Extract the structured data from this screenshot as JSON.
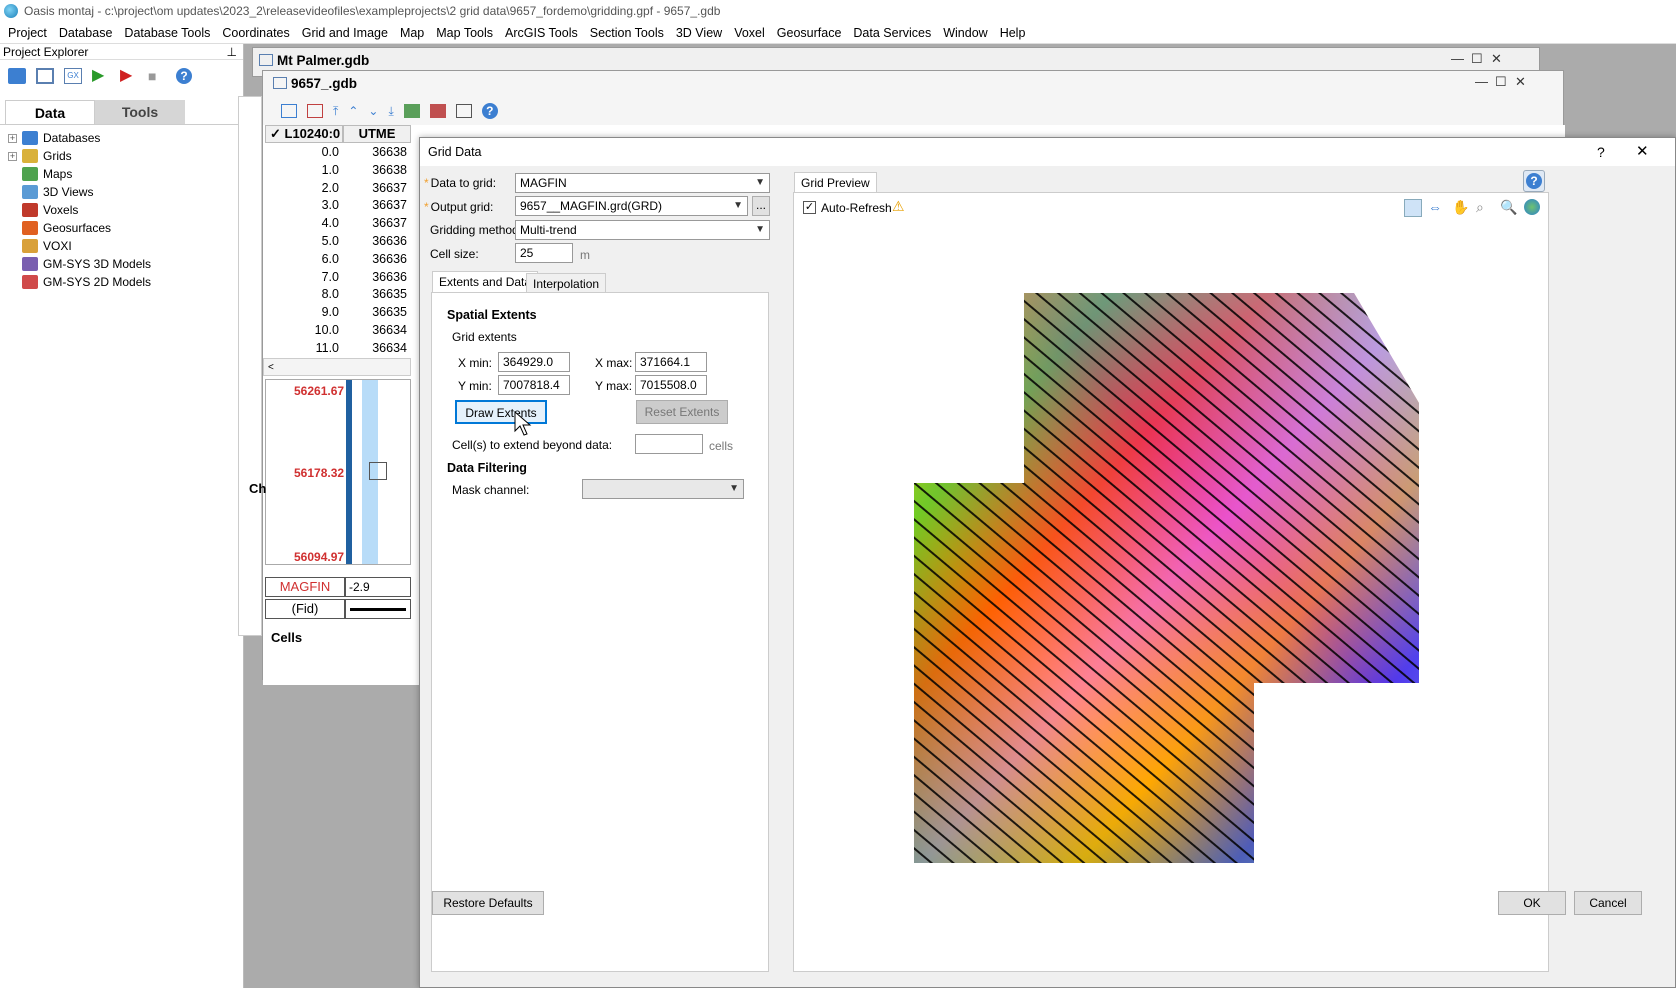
{
  "window_title": "Oasis montaj - c:\\project\\om updates\\2023_2\\releasevideofiles\\exampleprojects\\2 grid data\\9657_fordemo\\gridding.gpf - 9657_.gdb",
  "menu": [
    "Project",
    "Database",
    "Database Tools",
    "Coordinates",
    "Grid and Image",
    "Map",
    "Map Tools",
    "ArcGIS Tools",
    "Section Tools",
    "3D View",
    "Voxel",
    "Geosurface",
    "Data Services",
    "Window",
    "Help"
  ],
  "explorer": {
    "title": "Project Explorer",
    "tabs": {
      "data": "Data",
      "tools": "Tools"
    },
    "items": [
      {
        "label": "Databases",
        "expandable": true,
        "color": "#3c7fd1"
      },
      {
        "label": "Grids",
        "expandable": true,
        "color": "#d9b13a"
      },
      {
        "label": "Maps",
        "expandable": false,
        "color": "#4fa34f"
      },
      {
        "label": "3D Views",
        "expandable": false,
        "color": "#5b9bd5"
      },
      {
        "label": "Voxels",
        "expandable": false,
        "color": "#c0392b"
      },
      {
        "label": "Geosurfaces",
        "expandable": false,
        "color": "#e06020"
      },
      {
        "label": "VOXI",
        "expandable": false,
        "color": "#d9a13a"
      },
      {
        "label": "GM-SYS 3D Models",
        "expandable": false,
        "color": "#7a5fb0"
      },
      {
        "label": "GM-SYS 2D Models",
        "expandable": false,
        "color": "#d04a4a"
      }
    ]
  },
  "bg_windows": {
    "win1_title": "Mt Palmer.gdb",
    "win2_title": "9657_.gdb",
    "line_header": "L10240:0",
    "col_utme": "UTME",
    "fids": [
      "0.0",
      "1.0",
      "2.0",
      "3.0",
      "4.0",
      "5.0",
      "6.0",
      "7.0",
      "8.0",
      "9.0",
      "10.0",
      "11.0"
    ],
    "utme": [
      "36638",
      "36638",
      "36637",
      "36637",
      "36637",
      "36636",
      "36636",
      "36636",
      "36635",
      "36635",
      "36634",
      "36634"
    ],
    "profile_y": [
      "56261.67",
      "56178.32",
      "56094.97"
    ],
    "magfin_label": "MAGFIN",
    "magfin_value": "-2.9",
    "fid_label": "(Fid)",
    "ch_label": "Ch",
    "cells_label": "Cells"
  },
  "dialog": {
    "title": "Grid Data",
    "help": "?",
    "close": "✕",
    "data_to_grid_label": "Data to grid:",
    "data_to_grid_value": "MAGFIN",
    "output_grid_label": "Output grid:",
    "output_grid_value": "9657__MAGFIN.grd(GRD)",
    "browse": "...",
    "method_label": "Gridding method:",
    "method_value": "Multi-trend",
    "cell_size_label": "Cell size:",
    "cell_size_value": "25",
    "cell_size_unit": "m",
    "tab_extents": "Extents and Data",
    "tab_interp": "Interpolation",
    "spatial_extents": "Spatial Extents",
    "grid_extents": "Grid extents",
    "xmin_label": "X min:",
    "xmin_value": "364929.0",
    "xmax_label": "X max:",
    "xmax_value": "371664.1",
    "ymin_label": "Y min:",
    "ymin_value": "7007818.4",
    "ymax_label": "Y max:",
    "ymax_value": "7015508.0",
    "draw_extents": "Draw Extents",
    "reset_extents": "Reset Extents",
    "cells_beyond_label": "Cell(s) to extend beyond data:",
    "cells_beyond_value": "",
    "cells_unit": "cells",
    "data_filtering": "Data Filtering",
    "mask_channel_label": "Mask channel:",
    "mask_channel_value": "",
    "preview_tab": "Grid Preview",
    "auto_refresh": "Auto-Refresh",
    "restore_defaults": "Restore Defaults",
    "ok": "OK",
    "cancel": "Cancel"
  }
}
